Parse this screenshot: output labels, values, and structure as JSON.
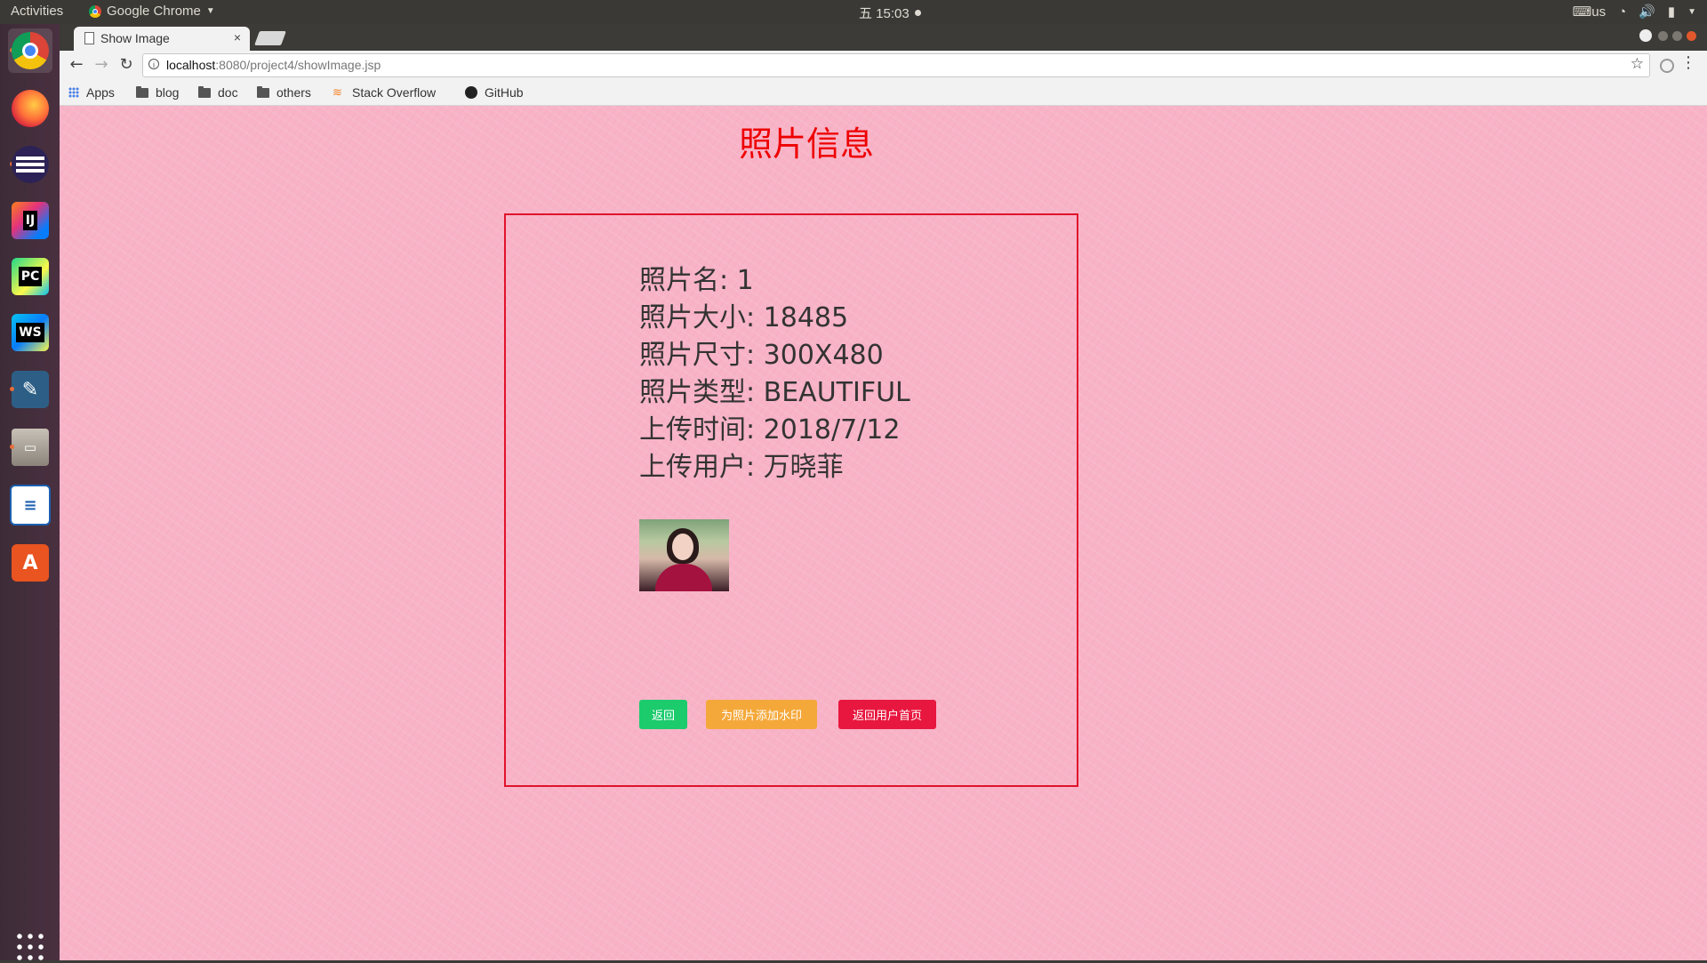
{
  "topbar": {
    "activities": "Activities",
    "app_name": "Google Chrome",
    "clock": "五 15:03",
    "keyboard": "us"
  },
  "launcher": {
    "items": [
      "chrome-icon",
      "firefox-icon",
      "eclipse-icon",
      "intellij-icon",
      "pycharm-icon",
      "webstorm-icon",
      "mysql-workbench-icon",
      "files-icon",
      "libreoffice-writer-icon",
      "software-center-icon",
      "show-apps-icon"
    ]
  },
  "browser": {
    "tab_title": "Show Image",
    "tab_close": "×",
    "url_host": "localhost",
    "url_rest": ":8080/project4/showImage.jsp",
    "bookmarks": [
      "Apps",
      "blog",
      "doc",
      "others",
      "Stack Overflow",
      "GitHub"
    ]
  },
  "page": {
    "title": "照片信息",
    "lines": [
      "照片名: 1",
      "照片大小: 18485",
      "照片尺寸: 300X480",
      "照片类型: BEAUTIFUL",
      "上传时间: 2018/7/12",
      "上传用户: 万晓菲"
    ],
    "buttons": {
      "back": "返回",
      "watermark": "为照片添加水印",
      "home": "返回用户首页"
    },
    "colors": {
      "background": "#f8b3c7",
      "title": "#ee0000",
      "border": "#e0132a",
      "back_button": "#1bcb6c",
      "watermark_button": "#f5a83a",
      "home_button": "#e8173f"
    }
  }
}
